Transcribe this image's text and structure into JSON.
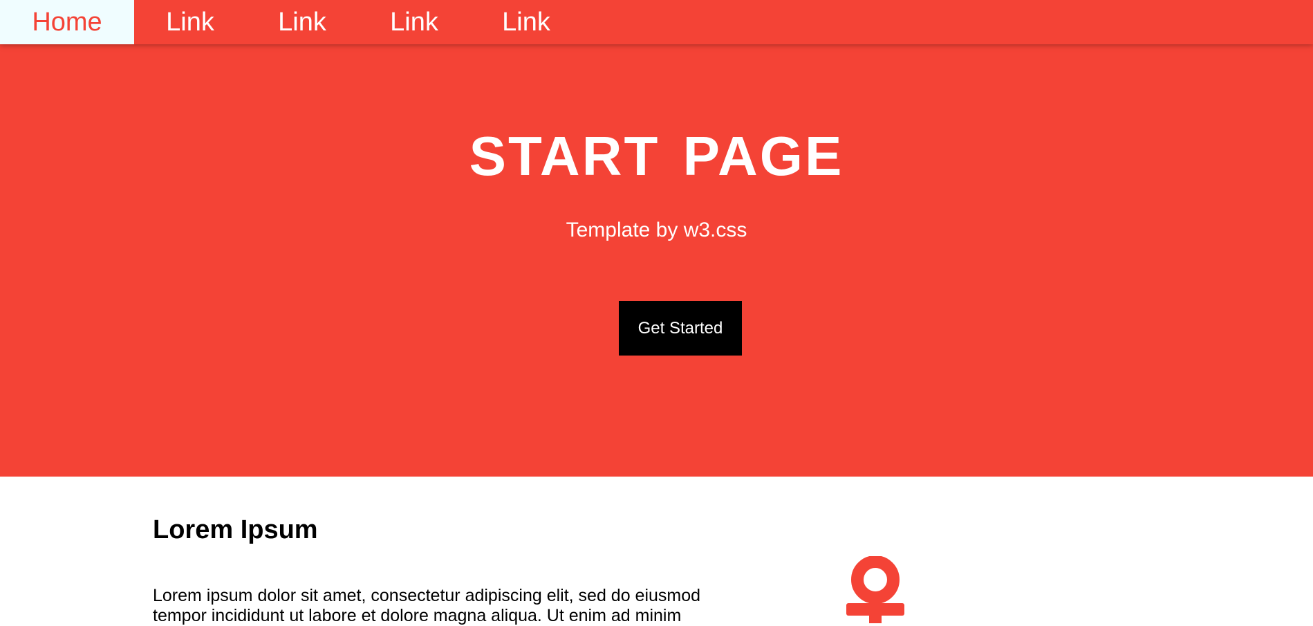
{
  "nav": {
    "home": "Home",
    "links": [
      "Link",
      "Link",
      "Link",
      "Link"
    ]
  },
  "hero": {
    "title": "START PAGE",
    "subtitle": "Template by w3.css",
    "button": "Get Started"
  },
  "content": {
    "title": "Lorem Ipsum",
    "body": "Lorem ipsum dolor sit amet, consectetur adipiscing elit, sed do eiusmod tempor incididunt ut labore et dolore magna aliqua. Ut enim ad minim",
    "icon": "anchor-icon"
  },
  "colors": {
    "accent": "#f44336",
    "home_bg": "#f0fdff",
    "button_bg": "#000000"
  }
}
